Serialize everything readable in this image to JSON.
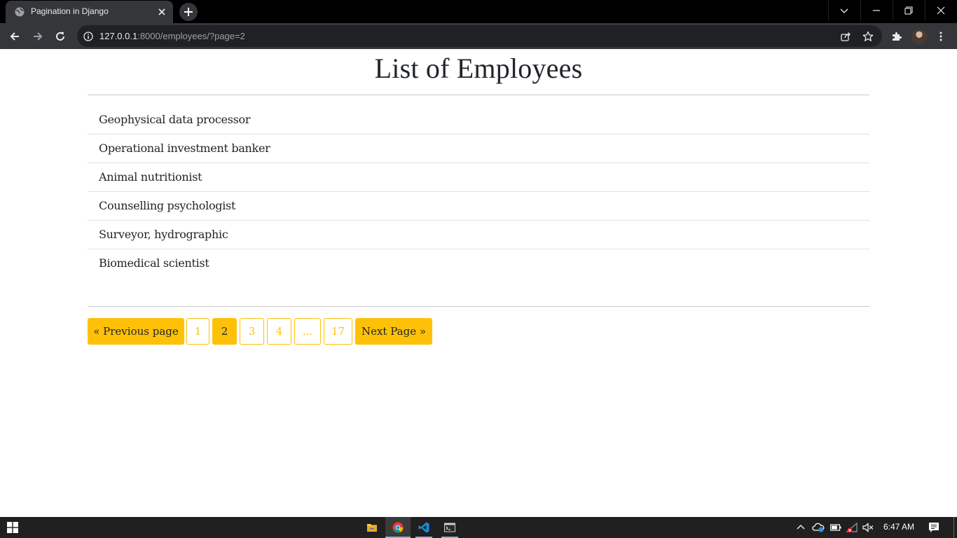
{
  "browser": {
    "tab_title": "Pagination in Django",
    "url_host": "127.0.0.1",
    "url_path": ":8000/employees/?page=2"
  },
  "page": {
    "title": "List of Employees",
    "employees": [
      "Geophysical data processor",
      "Operational investment banker",
      "Animal nutritionist",
      "Counselling psychologist",
      "Surveyor, hydrographic",
      "Biomedical scientist"
    ],
    "pagination": {
      "prev_label": "« Previous page",
      "pages": [
        "1",
        "2",
        "3",
        "4",
        "...",
        "17"
      ],
      "current_page": "2",
      "next_label": "Next Page »"
    }
  },
  "taskbar": {
    "clock": "6:47 AM"
  },
  "colors": {
    "accent": "#ffc107",
    "chrome_dark": "#35363a",
    "taskbar": "#202020"
  }
}
